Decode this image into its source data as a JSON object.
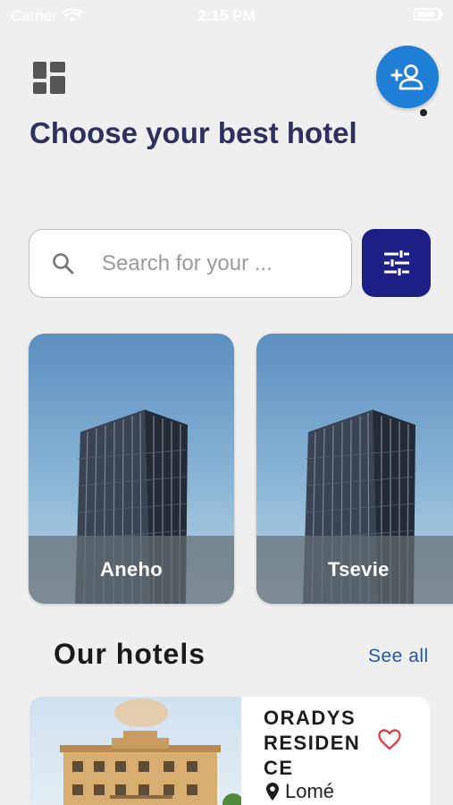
{
  "status_bar": {
    "carrier": "Carrier",
    "time": "2:15 PM"
  },
  "header": {
    "title": "Choose your best hotel"
  },
  "search": {
    "placeholder": "Search for your ..."
  },
  "cities": [
    {
      "name": "Aneho"
    },
    {
      "name": "Tsevie"
    }
  ],
  "hotels_section": {
    "title": "Our hotels",
    "see_all": "See all"
  },
  "hotels": [
    {
      "name": "ORADYS RESIDENCE",
      "location": "Lomé"
    }
  ],
  "icons": {
    "dashboard": "dashboard-icon",
    "add_user": "person-add-icon",
    "search": "search-icon",
    "filter": "tune-icon",
    "favorite": "heart-outline-icon",
    "location": "location-pin-icon"
  },
  "colors": {
    "title": "#2f2f60",
    "profile_button": "#1f7fd6",
    "filter_button": "#1d1f86",
    "link": "#1e5aa8",
    "favorite": "#d9434b"
  }
}
